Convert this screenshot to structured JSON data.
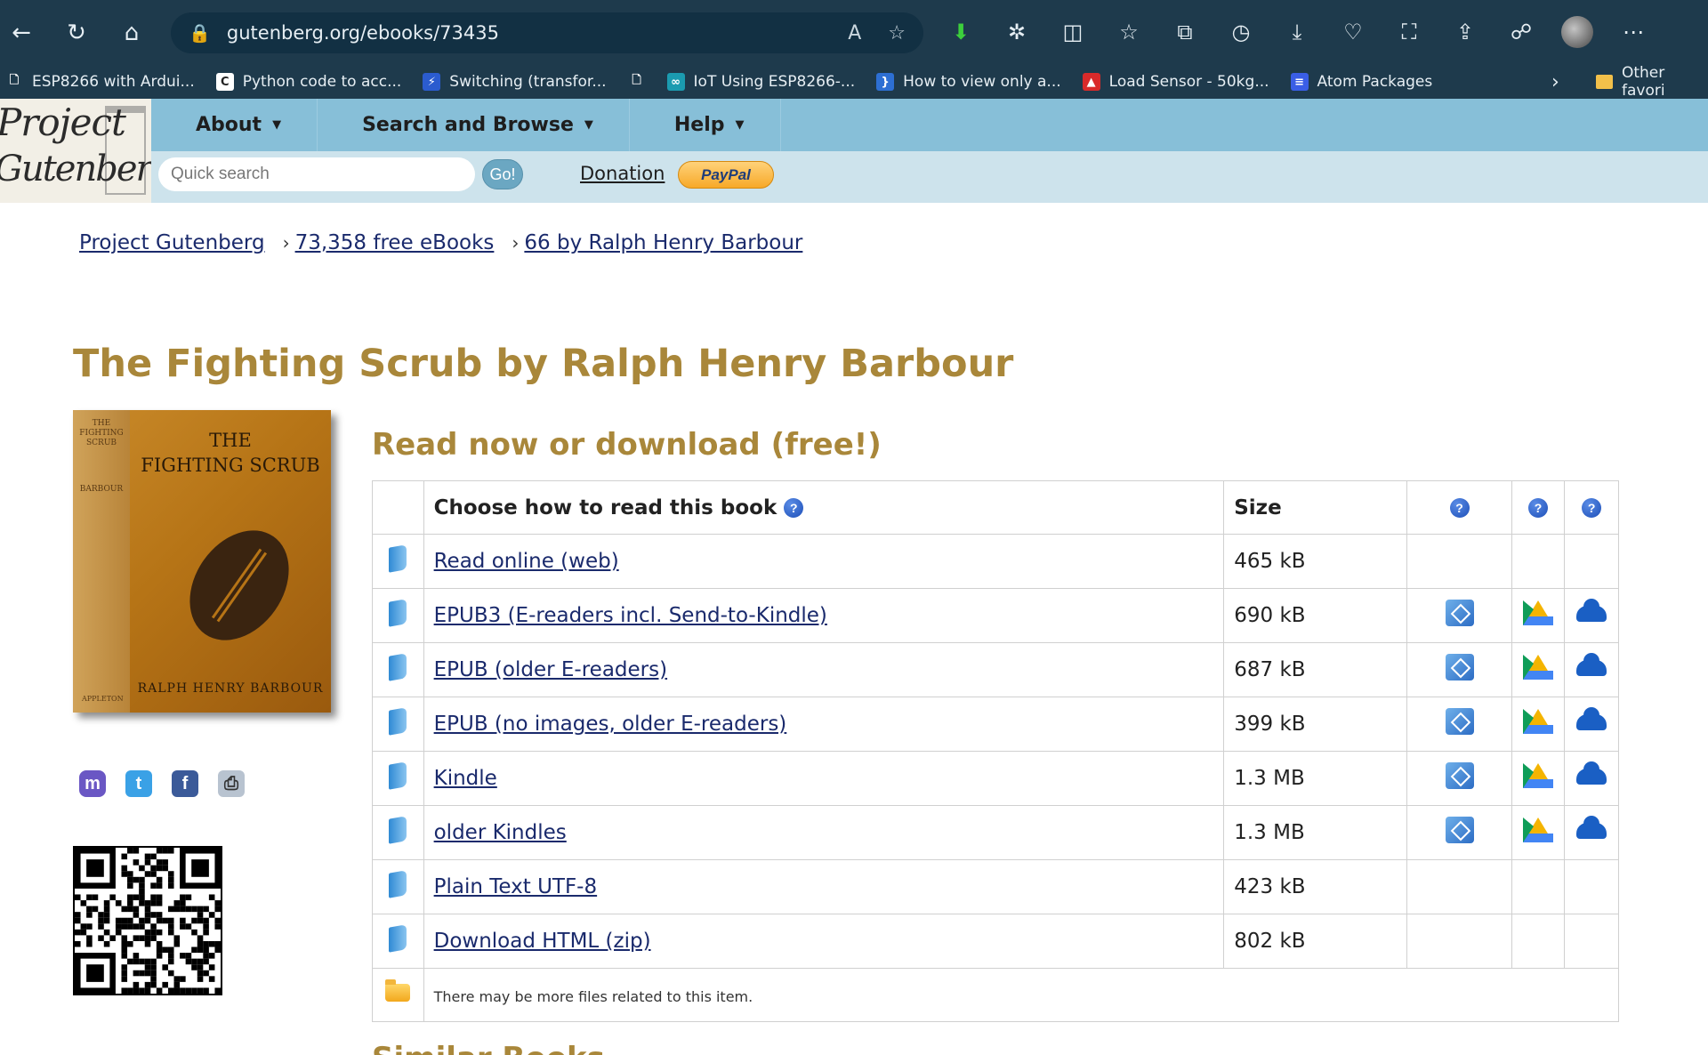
{
  "browser": {
    "url": "gutenberg.org/ebooks/73435",
    "bookmarks": [
      {
        "label": "ESP8266 with Ardui...",
        "icon": "document-icon"
      },
      {
        "label": "Python code to acc...",
        "icon": "c-icon"
      },
      {
        "label": "Switching (transfor...",
        "icon": "lightning-icon"
      },
      {
        "label": "",
        "icon": "document-icon"
      },
      {
        "label": "IoT Using ESP8266-...",
        "icon": "infinity-icon"
      },
      {
        "label": "How to view only a...",
        "icon": "bracket-icon"
      },
      {
        "label": "Load Sensor - 50kg...",
        "icon": "pdf-icon"
      },
      {
        "label": "Atom Packages",
        "icon": "atom-icon"
      }
    ],
    "other_favorites": "Other favori"
  },
  "site": {
    "logo_line1": "Project",
    "logo_line2": "Gutenberg",
    "menu": [
      {
        "label": "About"
      },
      {
        "label": "Search and Browse"
      },
      {
        "label": "Help"
      }
    ],
    "search_placeholder": "Quick search",
    "go_label": "Go!",
    "donation_label": "Donation",
    "paypal_label": "PayPal"
  },
  "breadcrumb": [
    {
      "label": "Project Gutenberg"
    },
    {
      "label": "73,358 free eBooks"
    },
    {
      "label": "66 by Ralph Henry Barbour"
    }
  ],
  "book": {
    "title": "The Fighting Scrub by Ralph Henry Barbour",
    "cover_title_line1": "THE",
    "cover_title_line2": "FIGHTING SCRUB",
    "cover_author": "RALPH HENRY BARBOUR",
    "cover_spine": "THE FIGHTING SCRUB",
    "cover_spine_author": "BARBOUR",
    "cover_publisher": "APPLETON"
  },
  "downloads": {
    "heading": "Read now or download (free!)",
    "col_choose": "Choose how to read this book",
    "col_size": "Size",
    "help_glyph": "?",
    "rows": [
      {
        "label": "Read online (web)",
        "size": "465 kB",
        "cloud": false
      },
      {
        "label": "EPUB3 (E-readers incl. Send-to-Kindle)",
        "size": "690 kB",
        "cloud": true
      },
      {
        "label": "EPUB (older E-readers)",
        "size": "687 kB",
        "cloud": true
      },
      {
        "label": "EPUB (no images, older E-readers)",
        "size": "399 kB",
        "cloud": true
      },
      {
        "label": "Kindle",
        "size": "1.3 MB",
        "cloud": true
      },
      {
        "label": "older Kindles",
        "size": "1.3 MB",
        "cloud": true
      },
      {
        "label": "Plain Text UTF-8",
        "size": "423 kB",
        "cloud": false
      },
      {
        "label": "Download HTML (zip)",
        "size": "802 kB",
        "cloud": false
      }
    ],
    "more_files_note": "There may be more files related to this item."
  },
  "similar_heading": "Similar Books",
  "colors": {
    "title_gold": "#a9873a",
    "menu_blue": "#87bfd8",
    "search_blue": "#cde3ec",
    "link_navy": "#1a2a6c",
    "chrome_dark": "#1e3a4c"
  }
}
